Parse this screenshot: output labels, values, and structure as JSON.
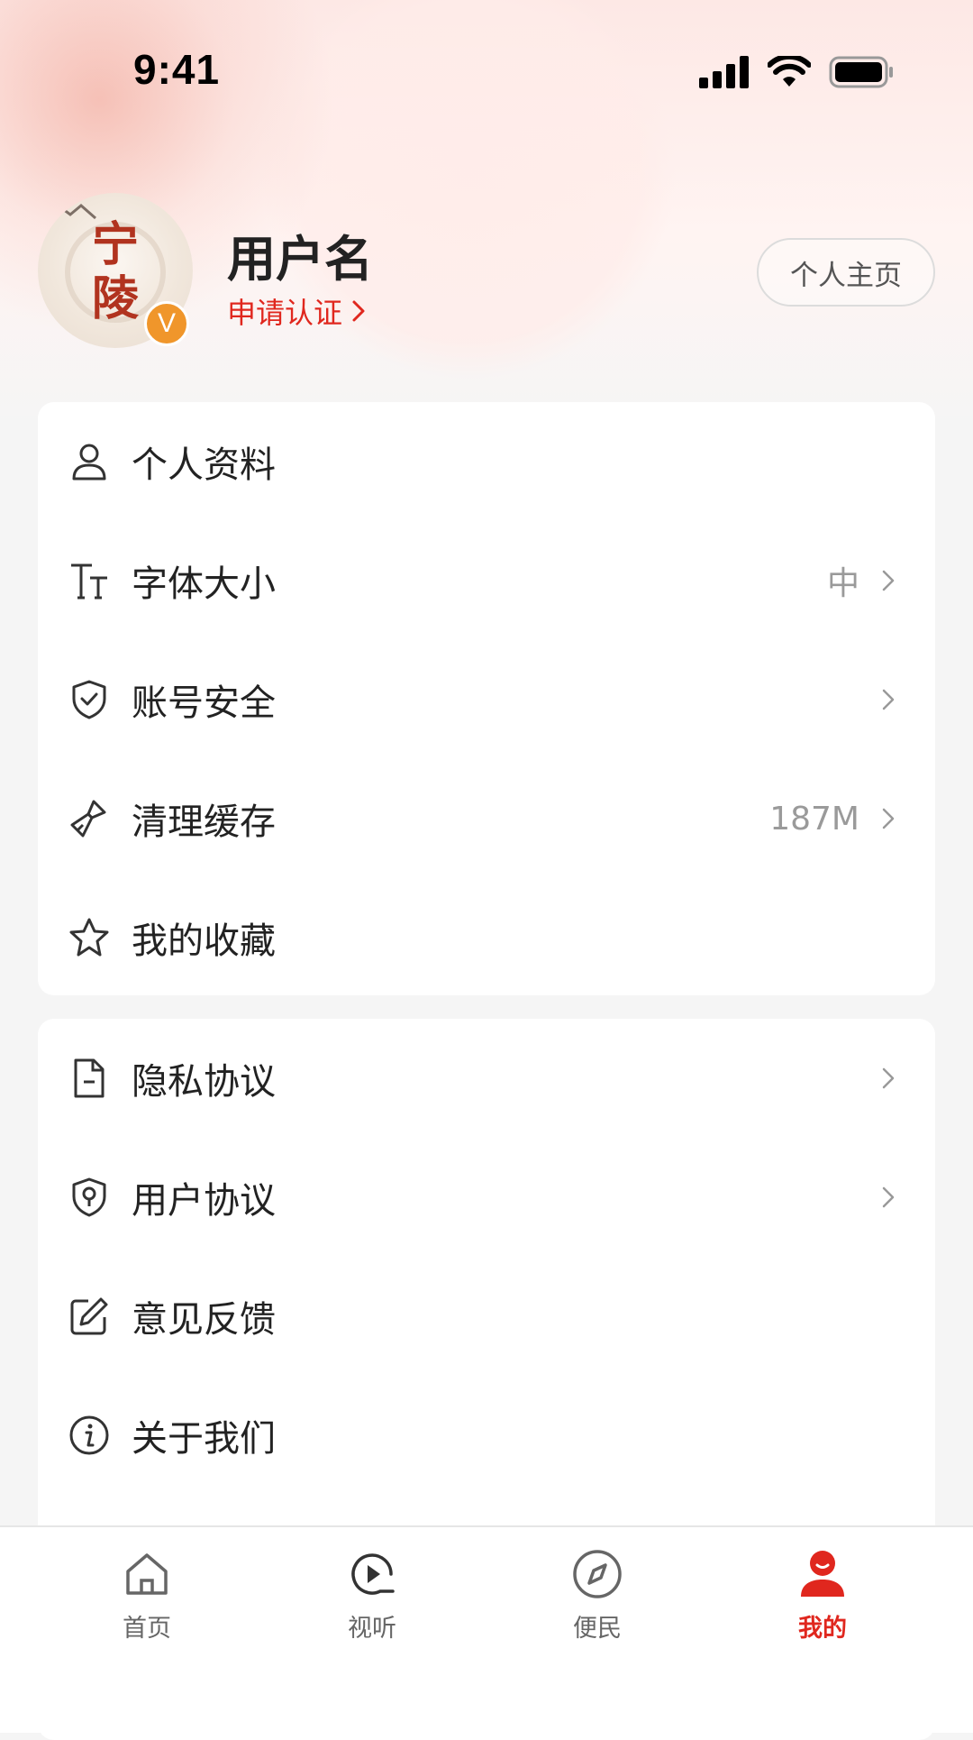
{
  "status_bar": {
    "time": "9:41"
  },
  "profile": {
    "avatar_text": "宁陵",
    "badge_text": "V",
    "username": "用户名",
    "verify_label": "申请认证",
    "homepage_button": "个人主页"
  },
  "menu_group_1": [
    {
      "label": "个人资料",
      "icon": "user-icon",
      "value": "",
      "chevron": false
    },
    {
      "label": "字体大小",
      "icon": "font-size-icon",
      "value": "中",
      "chevron": true
    },
    {
      "label": "账号安全",
      "icon": "shield-check-icon",
      "value": "",
      "chevron": true
    },
    {
      "label": "清理缓存",
      "icon": "broom-icon",
      "value": "187M",
      "chevron": true
    },
    {
      "label": "我的收藏",
      "icon": "star-icon",
      "value": "",
      "chevron": false
    }
  ],
  "menu_group_2": [
    {
      "label": "隐私协议",
      "icon": "document-icon",
      "value": "",
      "chevron": true
    },
    {
      "label": "用户协议",
      "icon": "shield-lock-icon",
      "value": "",
      "chevron": true
    },
    {
      "label": "意见反馈",
      "icon": "edit-icon",
      "value": "",
      "chevron": false
    },
    {
      "label": "关于我们",
      "icon": "info-icon",
      "value": "",
      "chevron": false
    }
  ],
  "tab_bar": {
    "tabs": [
      {
        "label": "首页",
        "icon": "home-icon",
        "active": false
      },
      {
        "label": "视听",
        "icon": "play-icon",
        "active": false
      },
      {
        "label": "便民",
        "icon": "compass-icon",
        "active": false
      },
      {
        "label": "我的",
        "icon": "profile-icon",
        "active": true
      }
    ]
  },
  "colors": {
    "accent": "#e0271e",
    "badge": "#f0962b",
    "text": "#222222",
    "muted": "#9a9a9a"
  }
}
